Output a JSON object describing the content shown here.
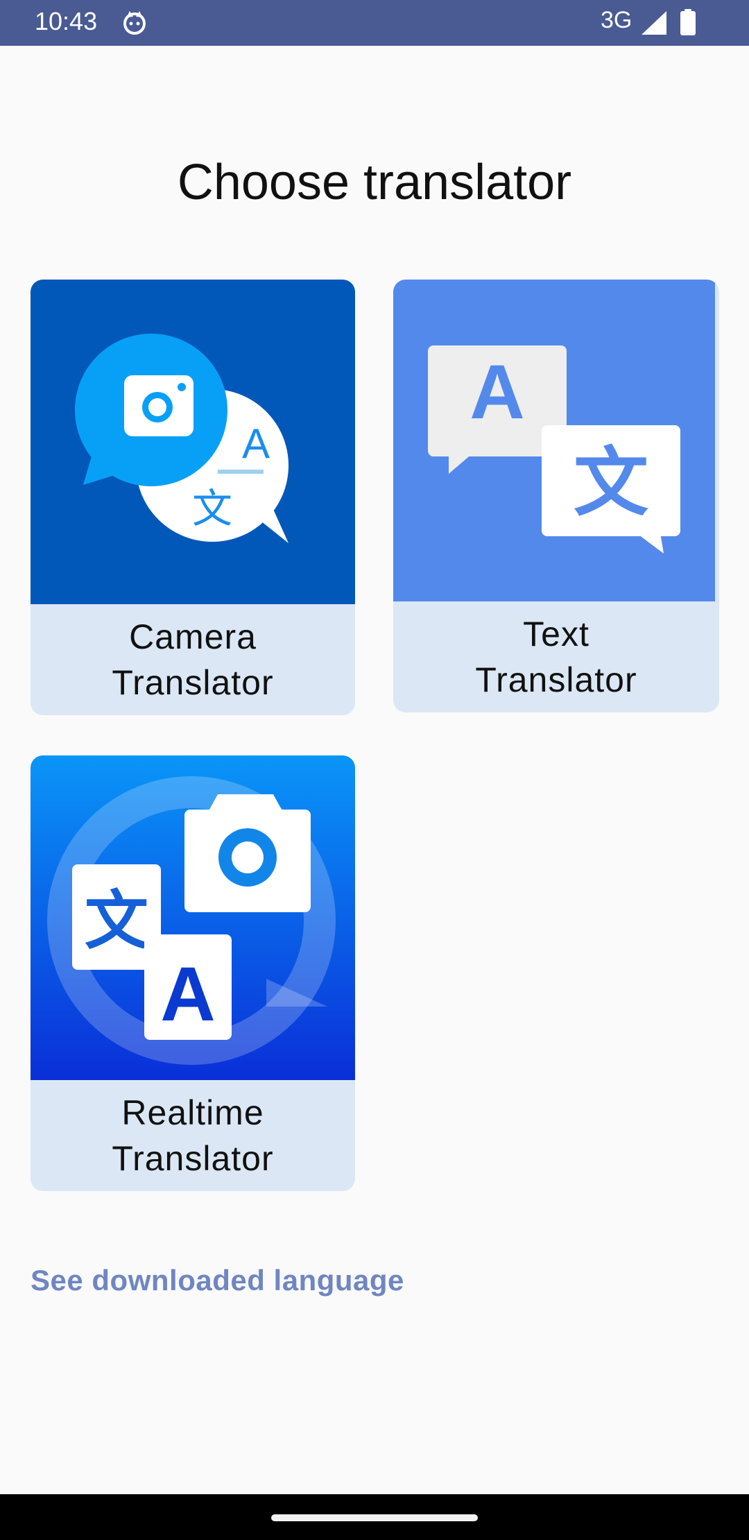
{
  "status_bar": {
    "time": "10:43",
    "network": "3G",
    "background_color": "#4a5a93",
    "icons": [
      "cat-face-icon",
      "signal-icon",
      "battery-icon"
    ]
  },
  "page": {
    "title": "Choose translator"
  },
  "cards": [
    {
      "line1": "Camera",
      "line2": "Translator",
      "icon": "camera-translate-bubbles-icon"
    },
    {
      "line1": "Text",
      "line2": "Translator",
      "icon": "text-translate-bubbles-icon"
    },
    {
      "line1": "Realtime",
      "line2": "Translator",
      "icon": "realtime-camera-translate-icon"
    }
  ],
  "link": {
    "label": "See downloaded language"
  },
  "colors": {
    "card_label_bg": "#dbe7f4",
    "link_color": "#6f86c2",
    "camera_card_bg": "#0258b9",
    "text_card_bg": "#5489ec"
  }
}
